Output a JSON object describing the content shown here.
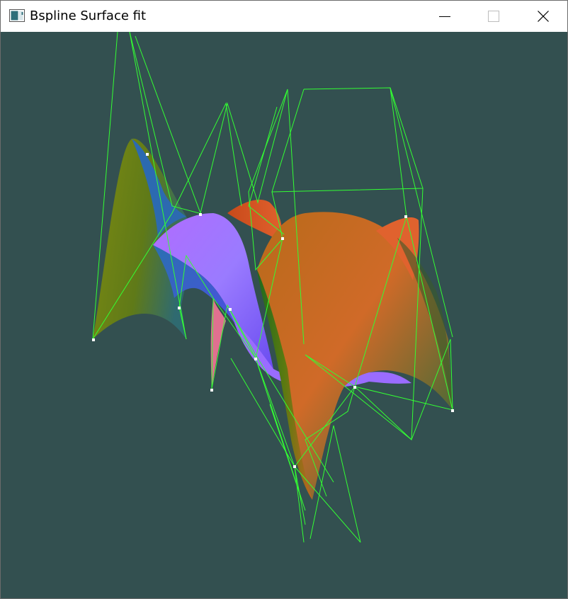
{
  "window": {
    "title": "Bspline Surface fit"
  },
  "controls": {
    "minimize_icon": "minimize-icon",
    "maximize_icon": "maximize-icon",
    "close_icon": "close-icon"
  },
  "scene": {
    "background_color": "#335050",
    "control_net_color": "#33ff33",
    "control_point_color": "#ffffff",
    "surface_colors": [
      "#6a7d10",
      "#c86a25",
      "#9a66ff",
      "#3060d0",
      "#2e7a2a",
      "#e05a30"
    ]
  }
}
